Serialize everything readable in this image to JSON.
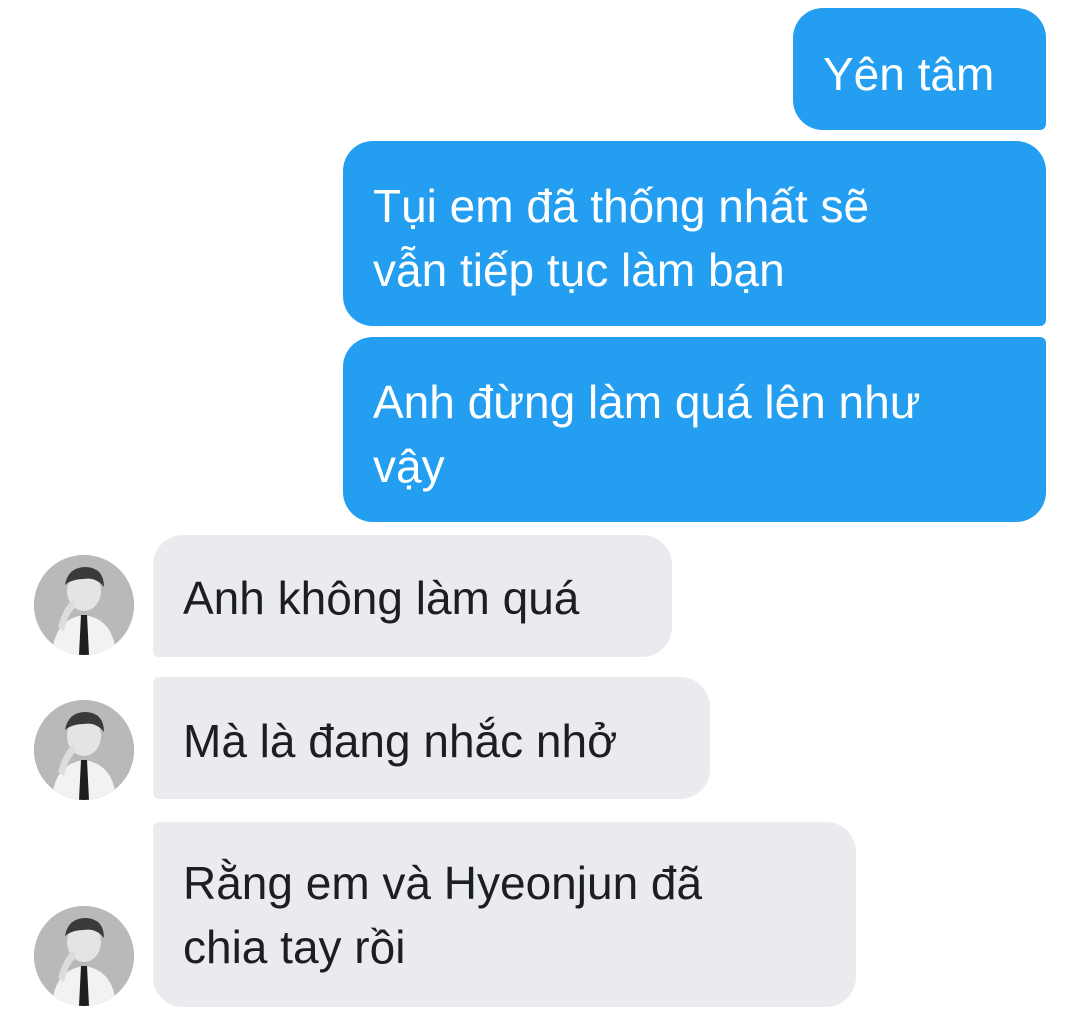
{
  "conversation": {
    "messages": [
      {
        "direction": "sent",
        "text": "Yên tâm"
      },
      {
        "direction": "sent",
        "lines": [
          "Tụi em đã thống nhất sẽ",
          "vẫn tiếp tục làm bạn"
        ]
      },
      {
        "direction": "sent",
        "lines": [
          "Anh đừng làm quá lên như",
          "vậy"
        ]
      },
      {
        "direction": "received",
        "text": "Anh không làm quá"
      },
      {
        "direction": "received",
        "text": "Mà là đang nhắc nhở"
      },
      {
        "direction": "received",
        "lines": [
          "Rằng em và Hyeonjun đã",
          "chia tay rồi"
        ]
      }
    ]
  },
  "avatar": {
    "icon": "profile-photo-grayscale"
  },
  "colors": {
    "sent_bubble": "#239ef0",
    "received_bubble": "#e9ebee",
    "sent_text": "#ffffff",
    "received_text": "#1c1e21"
  }
}
